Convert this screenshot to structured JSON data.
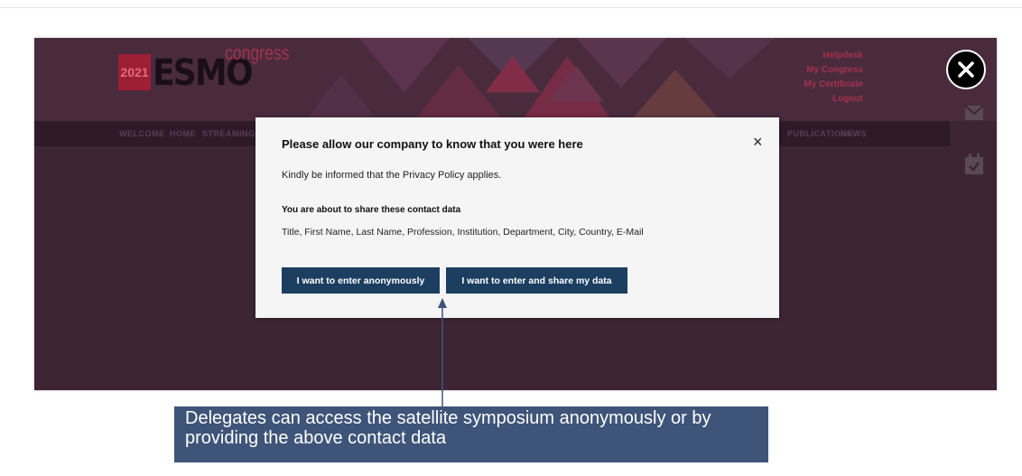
{
  "congress_logo": {
    "year": "2021",
    "wordmark": "ESMO",
    "suffix": "congress"
  },
  "top_links": [
    "Helpdesk",
    "My Congress",
    "My Certificate",
    "Logout"
  ],
  "nav_items": [
    "WELCOME",
    "HOME",
    "STREAMING",
    "PUBLICATIONS",
    "NEWS"
  ],
  "side_icons": [
    "envelope-icon",
    "calendar-check-icon"
  ],
  "overlay_close_icon": "close-icon",
  "modal": {
    "title": "Please allow our company to know that you were here",
    "close_glyph": "×",
    "privacy_text": "Kindly be informed that the Privacy Policy applies.",
    "share_heading": "You are about to share these contact data",
    "shared_fields": "Title, First Name, Last Name, Profession, Institution, Department, City, Country, E-Mail",
    "button_anonymous": "I want to enter anonymously",
    "button_share": "I want to enter and share my data"
  },
  "caption": {
    "text": "Delegates can access the satellite symposium anonymously or by providing the above contact data"
  },
  "colors": {
    "page_background": "#3d2536",
    "button": "#1c3e60",
    "caption_box": "#3e5479",
    "link_accent": "#a4314a"
  }
}
